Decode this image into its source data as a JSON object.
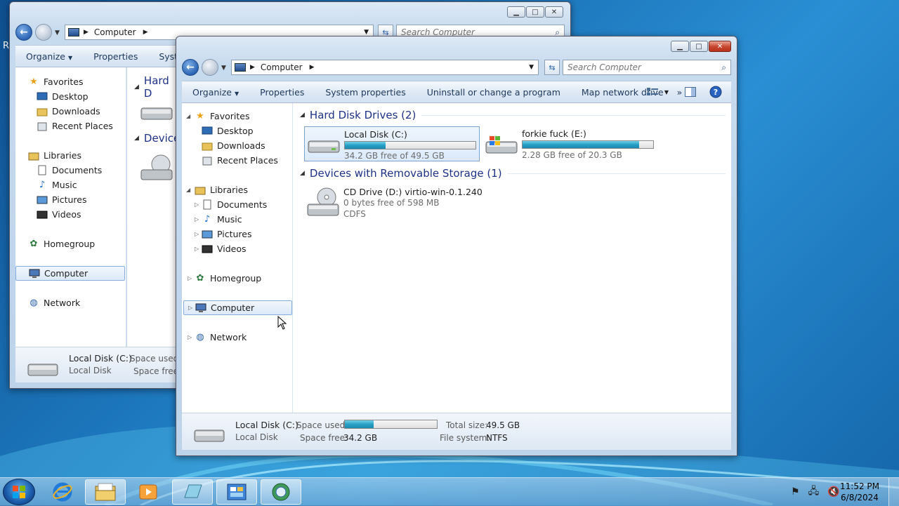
{
  "desktop": {
    "stray_glyph": "R"
  },
  "back_window": {
    "address": {
      "crumb": "Computer"
    },
    "search_placeholder": "Search Computer",
    "toolbar": {
      "organize": "Organize",
      "properties": "Properties",
      "system": "System"
    },
    "nav": {
      "favorites": "Favorites",
      "desktop": "Desktop",
      "downloads": "Downloads",
      "recent": "Recent Places",
      "libraries": "Libraries",
      "documents": "Documents",
      "music": "Music",
      "pictures": "Pictures",
      "videos": "Videos",
      "homegroup": "Homegroup",
      "computer": "Computer",
      "network": "Network"
    },
    "groups": {
      "hard": "Hard D",
      "devices": "Devices"
    },
    "details": {
      "name": "Local Disk (C:)",
      "type": "Local Disk",
      "space_used_label": "Space used:",
      "space_free_label": "Space free:"
    }
  },
  "front_window": {
    "address": {
      "crumb": "Computer"
    },
    "search_placeholder": "Search Computer",
    "toolbar": {
      "organize": "Organize",
      "properties": "Properties",
      "system_properties": "System properties",
      "uninstall": "Uninstall or change a program",
      "map_drive": "Map network drive",
      "more": "»"
    },
    "nav": {
      "favorites": "Favorites",
      "desktop": "Desktop",
      "downloads": "Downloads",
      "recent": "Recent Places",
      "libraries": "Libraries",
      "documents": "Documents",
      "music": "Music",
      "pictures": "Pictures",
      "videos": "Videos",
      "homegroup": "Homegroup",
      "computer": "Computer",
      "network": "Network"
    },
    "groups": {
      "hard_disk": "Hard Disk Drives (2)",
      "removable": "Devices with Removable Storage (1)"
    },
    "drives": [
      {
        "name": "Local Disk (C:)",
        "free_text": "34.2 GB free of 49.5 GB",
        "used_fraction": 0.31
      },
      {
        "name": "forkie fuck (E:)",
        "free_text": "2.28 GB free of 20.3 GB",
        "used_fraction": 0.89
      }
    ],
    "removable": {
      "name": "CD Drive (D:) virtio-win-0.1.240",
      "free_text": "0 bytes free of 598 MB",
      "fs": "CDFS"
    },
    "details": {
      "name": "Local Disk (C:)",
      "type": "Local Disk",
      "space_used_label": "Space used:",
      "space_free_label": "Space free:",
      "space_free_value": "34.2 GB",
      "total_size_label": "Total size:",
      "total_size_value": "49.5 GB",
      "file_system_label": "File system:",
      "file_system_value": "NTFS",
      "used_fraction": 0.31
    }
  },
  "taskbar": {
    "time": "11:52 PM",
    "date": "6/8/2024",
    "pinned": [
      "ie-icon",
      "explorer-icon",
      "media-player-icon",
      "notepad-icon",
      "control-panel-icon",
      "network-globe-icon"
    ]
  },
  "colors": {
    "accent_text": "#1e3287",
    "bar_fill": "#269fc4",
    "close_red": "#c6452e"
  }
}
